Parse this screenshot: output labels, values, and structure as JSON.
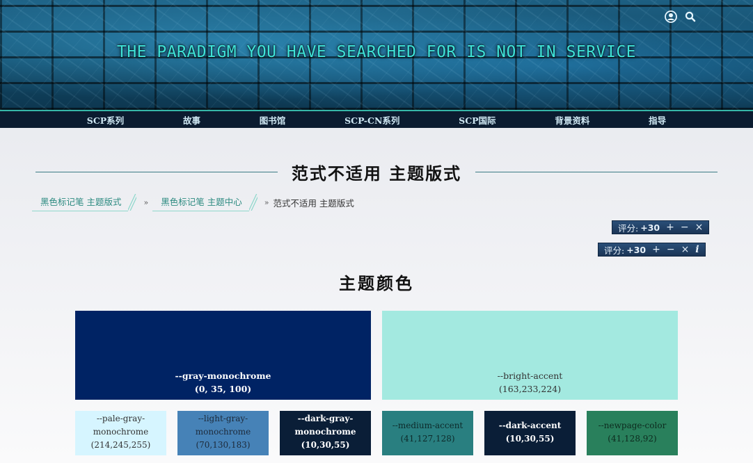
{
  "header": {
    "title": "THE PARADIGM YOU HAVE SEARCHED FOR IS NOT IN SERVICE"
  },
  "nav": {
    "items": [
      "SCP系列",
      "故事",
      "图书馆",
      "SCP-CN系列",
      "SCP国际",
      "背景资料",
      "指导"
    ]
  },
  "page": {
    "title": "范式不适用 主题版式"
  },
  "breadcrumb": {
    "items": [
      "黑色标记笔 主题版式",
      "黑色标记笔 主题中心"
    ],
    "separator": "»",
    "current": "范式不适用 主题版式"
  },
  "ratings": [
    {
      "label": "评分:",
      "score": "+30",
      "up": "+",
      "down": "−",
      "cancel": "×"
    },
    {
      "label": "评分:",
      "score": "+30",
      "up": "+",
      "down": "−",
      "cancel": "×",
      "info": "i"
    }
  ],
  "section": {
    "title": "主题颜色"
  },
  "swatches_primary": [
    {
      "name": "--gray-monochrome",
      "value": "(0, 35, 100)",
      "bg": "#002364",
      "fg": "#ffffff",
      "bold": true
    },
    {
      "name": "--bright-accent",
      "value": "(163,233,224)",
      "bg": "#a3e9e0",
      "fg": "#333333",
      "bold": false
    }
  ],
  "swatches_secondary": [
    {
      "name": "--pale-gray-monochrome",
      "value": "(214,245,255)",
      "bg": "#d6f5ff",
      "fg": "#333333",
      "bold": false
    },
    {
      "name": "--light-gray-monochrome",
      "value": "(70,130,183)",
      "bg": "#4682b7",
      "fg": "#1d2a3a",
      "bold": false
    },
    {
      "name": "--dark-gray-monochrome",
      "value": "(10,30,55)",
      "bg": "#0a1e37",
      "fg": "#ffffff",
      "bold": true
    },
    {
      "name": "--medium-accent",
      "value": "(41,127,128)",
      "bg": "#297f80",
      "fg": "#0d2a2a",
      "bold": false
    },
    {
      "name": "--dark-accent",
      "value": "(10,30,55)",
      "bg": "#0a1e37",
      "fg": "#ffffff",
      "bold": true
    },
    {
      "name": "--newpage-color",
      "value": "(41,128,92)",
      "bg": "#29805c",
      "fg": "#0d2a1e",
      "bold": false
    }
  ]
}
